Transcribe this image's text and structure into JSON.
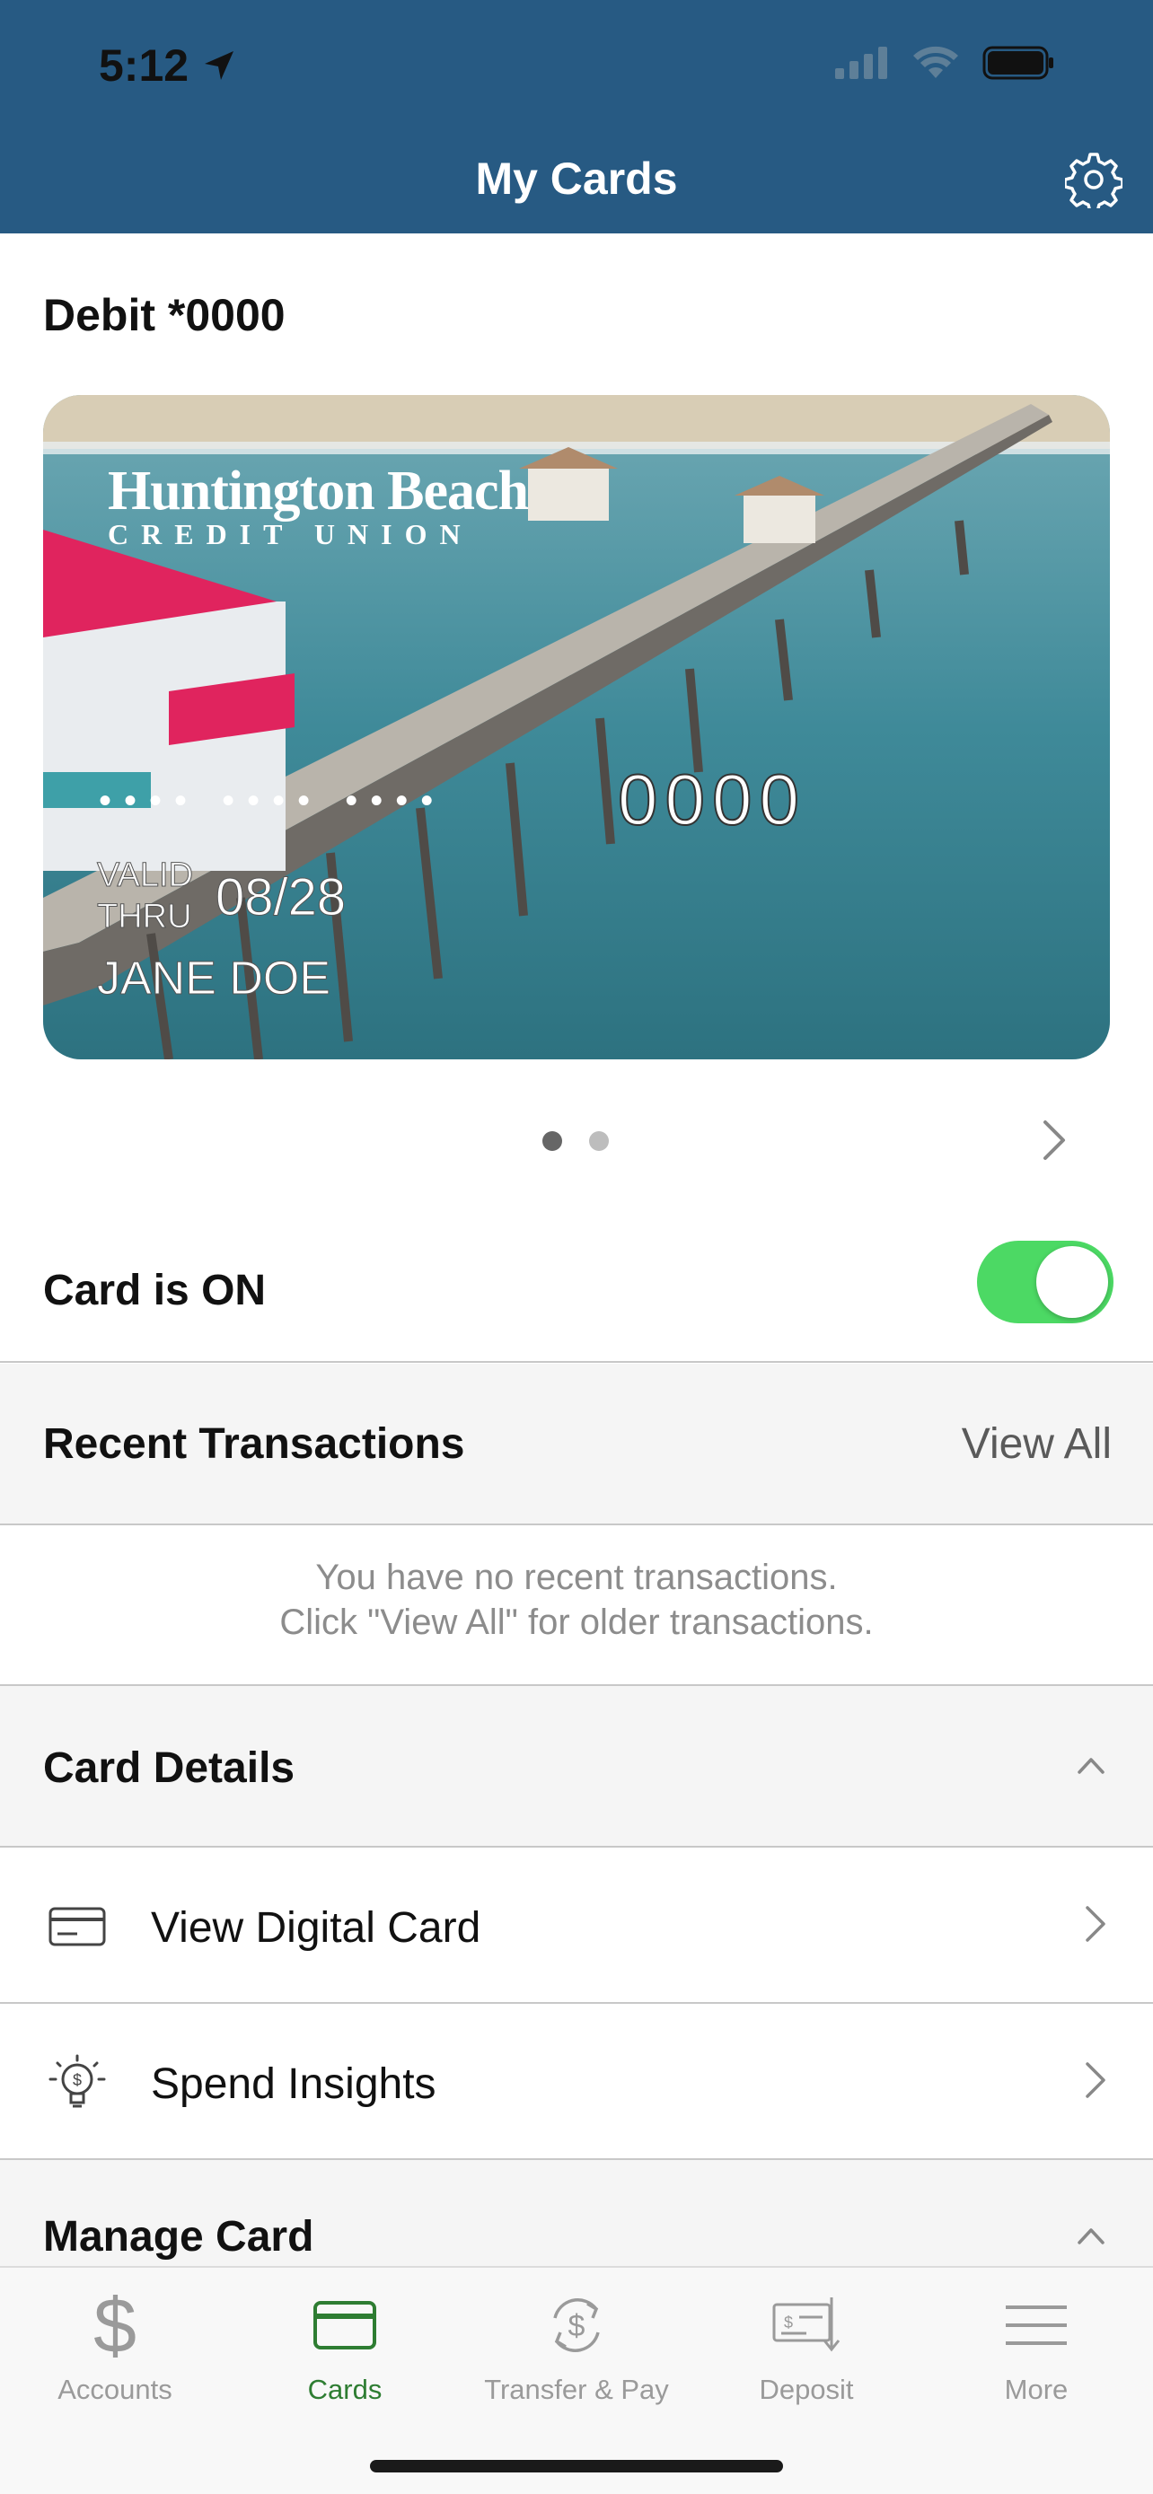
{
  "status_bar": {
    "time": "5:12"
  },
  "header": {
    "title": "My Cards"
  },
  "card_section": {
    "title": "Debit *0000"
  },
  "card": {
    "bank_name_line1": "Huntington Beach",
    "bank_name_line2": "CREDIT UNION",
    "masked_number": "•••• •••• ••••",
    "last4": "0000",
    "valid_label_1": "VALID",
    "valid_label_2": "THRU",
    "expiry": "08/28",
    "holder": "JANE DOE"
  },
  "pager": {
    "pages": 2,
    "current": 1
  },
  "card_toggle": {
    "label": "Card is ON",
    "on": true
  },
  "recent_transactions": {
    "title": "Recent Transactions",
    "view_all": "View All",
    "empty_line1": "You have no recent transactions.",
    "empty_line2": "Click \"View All\" for older transactions."
  },
  "card_details": {
    "title": "Card Details",
    "items": [
      {
        "label": "View Digital Card",
        "icon": "credit-card-icon"
      },
      {
        "label": "Spend Insights",
        "icon": "lightbulb-dollar-icon"
      }
    ]
  },
  "manage_card": {
    "title": "Manage Card"
  },
  "tabbar": {
    "items": [
      {
        "label": "Accounts",
        "icon": "dollar-icon",
        "active": false
      },
      {
        "label": "Cards",
        "icon": "card-icon",
        "active": true
      },
      {
        "label": "Transfer & Pay",
        "icon": "transfer-dollar-icon",
        "active": false
      },
      {
        "label": "Deposit",
        "icon": "check-deposit-icon",
        "active": false
      },
      {
        "label": "More",
        "icon": "menu-icon",
        "active": false
      }
    ]
  },
  "colors": {
    "header_bg": "#275a83",
    "toggle_on": "#4cd964",
    "tab_active": "#2e7d32",
    "section_bg": "#f5f5f5"
  }
}
